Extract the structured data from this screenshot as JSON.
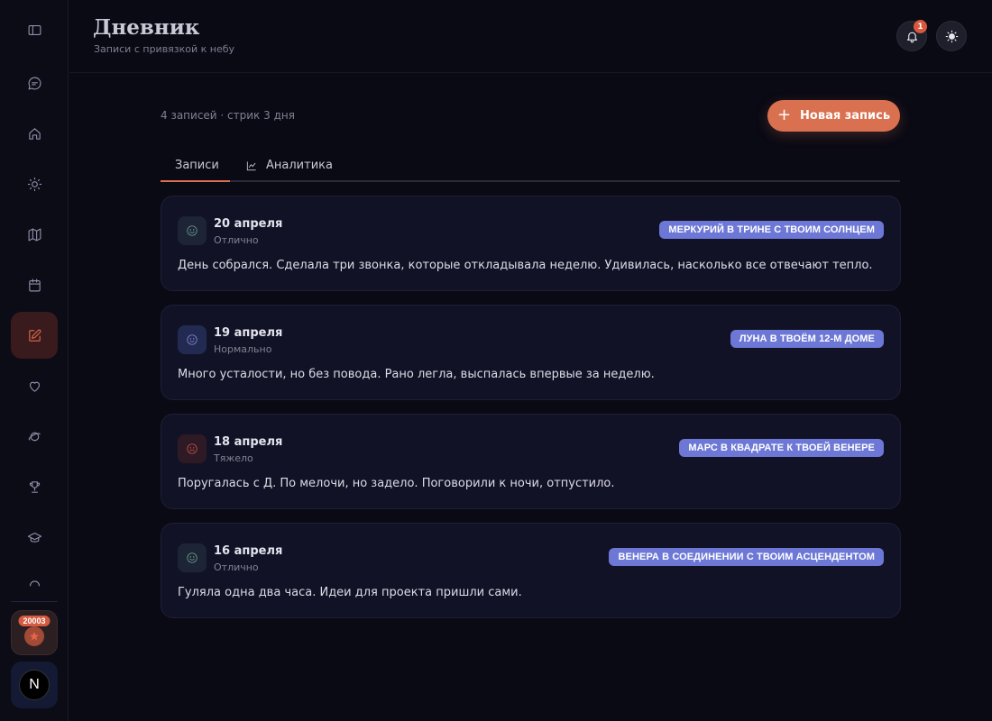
{
  "header": {
    "title": "Дневник",
    "subtitle": "Записи с привязкой к небу",
    "notification_count": "1"
  },
  "sidebar": {
    "items": [
      {
        "icon": "panel-toggle-icon"
      },
      {
        "icon": "chat-icon"
      },
      {
        "icon": "home-icon"
      },
      {
        "icon": "sun-icon"
      },
      {
        "icon": "map-icon"
      },
      {
        "icon": "calendar-icon"
      },
      {
        "icon": "edit-icon",
        "active": true
      },
      {
        "icon": "heart-icon"
      },
      {
        "icon": "planet-icon"
      },
      {
        "icon": "trophy-icon"
      },
      {
        "icon": "graduation-cap-icon"
      }
    ],
    "points": "20003",
    "avatar_letter": "N"
  },
  "main": {
    "meta": "4 записей · стрик 3 дня",
    "new_entry_label": "Новая запись",
    "tabs": [
      {
        "label": "Записи",
        "active": true
      },
      {
        "label": "Аналитика",
        "icon": "chart-icon"
      }
    ],
    "entries": [
      {
        "date": "20 апреля",
        "mood": "Отлично",
        "tag": "МЕРКУРИЙ В ТРИНЕ С ТВОИМ СОЛНЦЕМ",
        "text": "День собрался. Сделала три звонка, которые откладывала неделю. Удивилась, насколько все отвечают тепло."
      },
      {
        "date": "19 апреля",
        "mood": "Нормально",
        "tag": "ЛУНА В ТВОЁМ 12-М ДОМЕ",
        "text": "Много усталости, но без повода. Рано легла, выспалась впервые за неделю."
      },
      {
        "date": "18 апреля",
        "mood": "Тяжело",
        "tag": "МАРС В КВАДРАТЕ К ТВОЕЙ ВЕНЕРЕ",
        "text": "Поругалась с Д. По мелочи, но задело. Поговорили к ночи, отпустило."
      },
      {
        "date": "16 апреля",
        "mood": "Отлично",
        "tag": "ВЕНЕРА В СОЕДИНЕНИИ С ТВОИМ АСЦЕНДЕНТОМ",
        "text": "Гуляла одна два часа. Идеи для проекта пришли сами."
      }
    ]
  },
  "colors": {
    "accent": "#d9704f",
    "tag": "#6d78d6",
    "background": "#0a0a14"
  }
}
